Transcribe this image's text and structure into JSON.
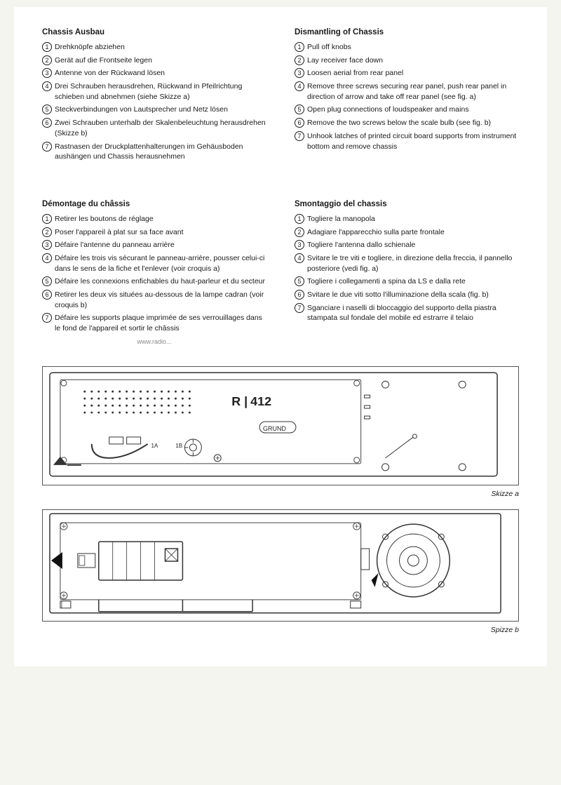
{
  "sections": {
    "german": {
      "title": "Chassis Ausbau",
      "items": [
        "Drehknöpfe abziehen",
        "Gerät auf die Frontseite legen",
        "Antenne von der Rückwand lösen",
        "Drei Schrauben herausdrehen, Rückwand in Pfeilrichtung schieben und abnehmen (siehe Skizze a)",
        "Steckverbindungen von Lautsprecher und Netz lösen",
        "Zwei Schrauben unterhalb der Skalenbeleuchtung herausdrehen (Skizze b)",
        "Rastnasen der Druckplattenhalterungen im Gehäusboden aushängen und Chassis herausnehmen"
      ]
    },
    "english": {
      "title": "Dismantling of Chassis",
      "items": [
        "Pull off knobs",
        "Lay receiver face down",
        "Loosen aerial from rear panel",
        "Remove three screws securing rear panel, push rear panel in direction of arrow and take off rear panel (see fig. a)",
        "Open plug connections of loudspeaker and mains",
        "Remove the two screws below the scale bulb (see fig. b)",
        "Unhook latches of printed circuit board supports from instrument bottom and remove chassis"
      ]
    },
    "french": {
      "title": "Démontage du châssis",
      "items": [
        "Retirer les boutons de réglage",
        "Poser l'appareil à plat sur sa face avant",
        "Défaire l'antenne du panneau arrière",
        "Défaire les trois vis sécurant le panneau-arrière, pousser celui-ci dans le sens de la fiche et l'enlever (voir croquis a)",
        "Défaire les connexions enfichables du haut-parleur et du secteur",
        "Retirer les deux vis situées au-dessous de la lampe cadran (voir croquis b)",
        "Défaire les supports plaque imprimée de ses verrouillages dans le fond de l'appareil et sortir le châssis"
      ]
    },
    "italian": {
      "title": "Smontaggio del chassis",
      "items": [
        "Togliere la manopola",
        "Adagiare l'apparecchio sulla parte frontale",
        "Togliere l'antenna dallo schienale",
        "Svitare le tre viti e togliere, in direzione della freccia, il pannello posteriore (vedi fig. a)",
        "Togliere i collegamenti a spina da LS e dalla rete",
        "Svitare le due viti sotto l'illuminazione della scala (fig. b)",
        "Sganciare i naselli di bloccaggio del supporto della piastra stampata sul fondale del mobile ed estrarre il telaio"
      ]
    },
    "diagrams": {
      "diagram_a_label": "Skizze a",
      "diagram_b_label": "Spizze b"
    }
  }
}
